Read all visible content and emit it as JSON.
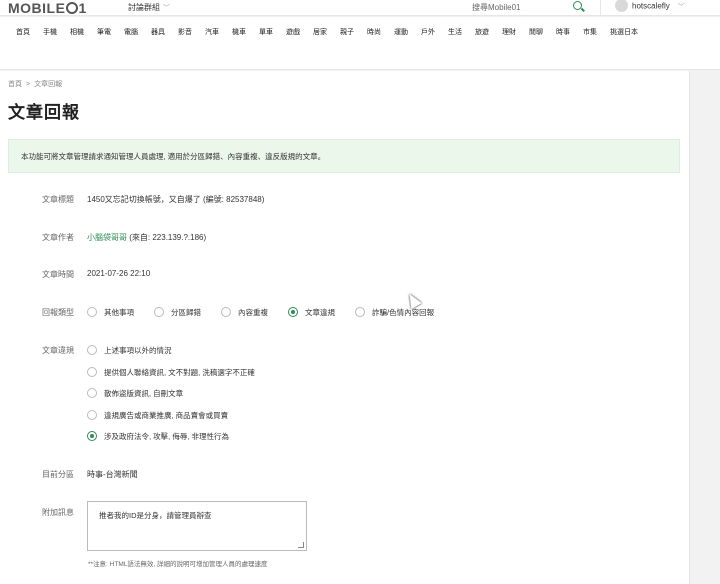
{
  "header": {
    "logo": "MOBILE01",
    "forum_group": "討論群組",
    "search_placeholder": "搜尋Mobile01",
    "username": "hotscalefly"
  },
  "categories": [
    "首頁",
    "手機",
    "相機",
    "筆電",
    "電腦",
    "器具",
    "影音",
    "汽車",
    "機車",
    "單車",
    "遊戲",
    "居家",
    "親子",
    "時尚",
    "運動",
    "戶外",
    "生活",
    "旅遊",
    "理財",
    "閒聊",
    "時事",
    "市集",
    "挑選日本"
  ],
  "breadcrumb": {
    "home": "首頁",
    "sep": ">",
    "current": "文章回報"
  },
  "page_title": "文章回報",
  "notice": "本功能可將文章管理請求通知管理人員處理, 適用於分區歸錯、內容重複、違反版規的文章。",
  "fields": {
    "title_label": "文章標題",
    "title_value": "1450又忘記切換帳號，又自爆了 (編號: 82537848)",
    "author_label": "文章作者",
    "author_name": "小腦袋哥哥",
    "author_ip": "(來自: 223.139.?.186)",
    "time_label": "文章時間",
    "time_value": "2021-07-26 22:10",
    "type_label": "回報類型",
    "type_options": [
      "其他事項",
      "分區歸錯",
      "內容重複",
      "文章違規",
      "詐騙/色情內容回報"
    ],
    "type_selected": 3,
    "violation_label": "文章違規",
    "violation_options": [
      "上述事項以外的情況",
      "提供個人聯絡資訊, 文不對題, 洗稿選字不正確",
      "散佈盜版資訊, 自刪文章",
      "違規廣告或商業推廣, 商品賣會或買賣",
      "涉及政府法令, 攻擊, 侮辱, 非理性行為"
    ],
    "violation_selected": 4,
    "section_label": "目前分區",
    "section_value": "時事-台灣新聞",
    "extra_label": "附加訊息",
    "extra_value": "推者我的ID是分身，請管理員辦查",
    "hint": "**注意: HTML語法無效, 詳細的說明可增加管理人員的處理速度"
  }
}
